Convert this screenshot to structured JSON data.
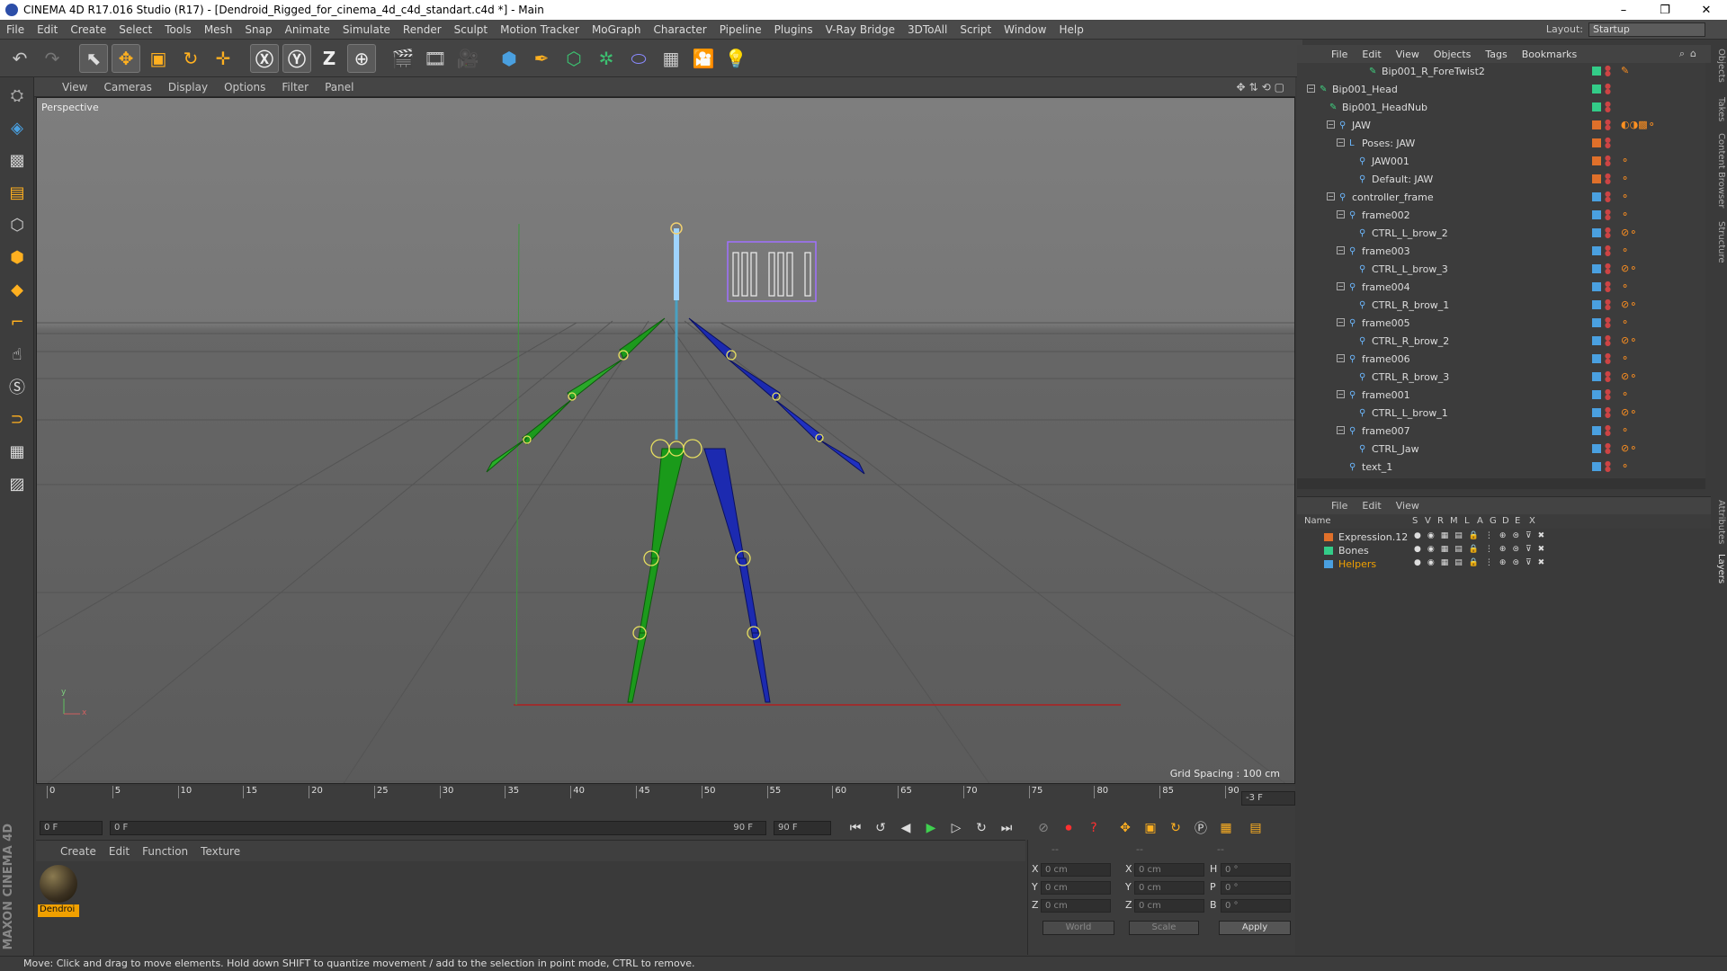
{
  "window": {
    "title": "CINEMA 4D R17.016 Studio (R17) - [Dendroid_Rigged_for_cinema_4d_c4d_standart.c4d *] - Main",
    "controls": [
      "–",
      "❐",
      "✕"
    ]
  },
  "menubar": {
    "items": [
      "File",
      "Edit",
      "Create",
      "Select",
      "Tools",
      "Mesh",
      "Snap",
      "Animate",
      "Simulate",
      "Render",
      "Sculpt",
      "Motion Tracker",
      "MoGraph",
      "Character",
      "Pipeline",
      "Plugins",
      "V-Ray Bridge",
      "3DToAll",
      "Script",
      "Window",
      "Help"
    ],
    "layout_label": "Layout:",
    "layout_value": "Startup"
  },
  "viewport": {
    "menu": [
      "View",
      "Cameras",
      "Display",
      "Options",
      "Filter",
      "Panel"
    ],
    "camera_label": "Perspective",
    "grid_spacing": "Grid Spacing : 100 cm",
    "axis_y": "y",
    "axis_x": "x"
  },
  "timeline": {
    "ticks": [
      "0",
      "5",
      "10",
      "15",
      "20",
      "25",
      "30",
      "35",
      "40",
      "45",
      "50",
      "55",
      "60",
      "65",
      "70",
      "75",
      "80",
      "85",
      "90"
    ],
    "current_frame": "-3 F",
    "start_field": "0 F",
    "range_start": "0 F",
    "range_end": "90 F",
    "end_field": "90 F"
  },
  "material_manager": {
    "menu": [
      "Create",
      "Edit",
      "Function",
      "Texture"
    ],
    "materials": [
      {
        "name": "Dendroi"
      }
    ]
  },
  "coordinates": {
    "header": [
      "--",
      "--",
      "--"
    ],
    "rows": [
      {
        "l1": "X",
        "v1": "0 cm",
        "l2": "X",
        "v2": "0 cm",
        "l3": "H",
        "v3": "0 °"
      },
      {
        "l1": "Y",
        "v1": "0 cm",
        "l2": "Y",
        "v2": "0 cm",
        "l3": "P",
        "v3": "0 °"
      },
      {
        "l1": "Z",
        "v1": "0 cm",
        "l2": "Z",
        "v2": "0 cm",
        "l3": "B",
        "v3": "0 °"
      }
    ],
    "space": "World",
    "mode": "Scale",
    "apply": "Apply"
  },
  "object_manager": {
    "menu": [
      "File",
      "Edit",
      "View",
      "Objects",
      "Tags",
      "Bookmarks"
    ],
    "rows": [
      {
        "name": "Bip001_R_ForeTwist2",
        "color": "#33cc88"
      },
      {
        "name": "Bip001_Head",
        "color": "#33cc88"
      },
      {
        "name": "Bip001_HeadNub",
        "color": "#33cc88"
      },
      {
        "name": "JAW",
        "color": "#e0702a"
      },
      {
        "name": "Poses: JAW",
        "color": "#e0702a"
      },
      {
        "name": "JAW001",
        "color": "#e0702a"
      },
      {
        "name": "Default: JAW",
        "color": "#e0702a"
      },
      {
        "name": "controller_frame",
        "color": "#4aa0e0"
      },
      {
        "name": "frame002",
        "color": "#4aa0e0"
      },
      {
        "name": "CTRL_L_brow_2",
        "color": "#4aa0e0"
      },
      {
        "name": "frame003",
        "color": "#4aa0e0"
      },
      {
        "name": "CTRL_L_brow_3",
        "color": "#4aa0e0"
      },
      {
        "name": "frame004",
        "color": "#4aa0e0"
      },
      {
        "name": "CTRL_R_brow_1",
        "color": "#4aa0e0"
      },
      {
        "name": "frame005",
        "color": "#4aa0e0"
      },
      {
        "name": "CTRL_R_brow_2",
        "color": "#4aa0e0"
      },
      {
        "name": "frame006",
        "color": "#4aa0e0"
      },
      {
        "name": "CTRL_R_brow_3",
        "color": "#4aa0e0"
      },
      {
        "name": "frame001",
        "color": "#4aa0e0"
      },
      {
        "name": "CTRL_L_brow_1",
        "color": "#4aa0e0"
      },
      {
        "name": "frame007",
        "color": "#4aa0e0"
      },
      {
        "name": "CTRL_Jaw",
        "color": "#4aa0e0"
      },
      {
        "name": "text_1",
        "color": "#4aa0e0"
      }
    ]
  },
  "layer_manager": {
    "menu": [
      "File",
      "Edit",
      "View"
    ],
    "columns": [
      "Name",
      "S",
      "V",
      "R",
      "M",
      "L",
      "A",
      "G",
      "D",
      "E",
      "X"
    ],
    "layers": [
      {
        "name": "Expression.12",
        "color": "#e0702a",
        "text_color": "#dcdcdc"
      },
      {
        "name": "Bones",
        "color": "#33cc88",
        "text_color": "#dcdcdc"
      },
      {
        "name": "Helpers",
        "color": "#4aa0e0",
        "text_color": "#f0a000"
      }
    ]
  },
  "right_tabs": [
    "Objects",
    "Takes",
    "Content Browser",
    "Structure",
    "Attributes",
    "Layers"
  ],
  "status": "Move: Click and drag to move elements. Hold down SHIFT to quantize movement / add to the selection in point mode, CTRL to remove.",
  "brand": "MAXON CINEMA 4D"
}
